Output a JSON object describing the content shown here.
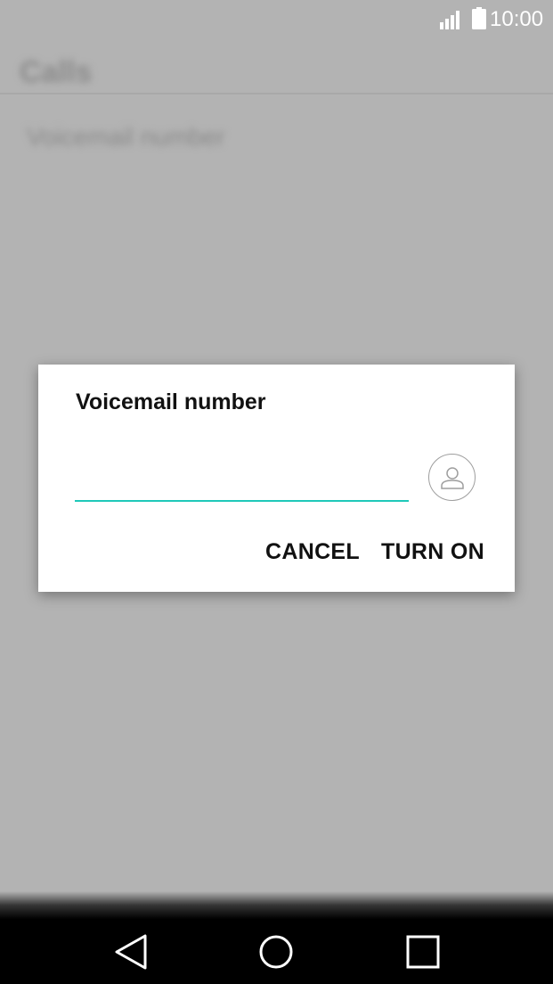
{
  "status_bar": {
    "time": "10:00",
    "signal_icon": "signal-icon",
    "battery_icon": "battery-icon"
  },
  "background": {
    "title": "Calls",
    "row_text": "Voicemail number"
  },
  "dialog": {
    "title": "Voicemail number",
    "input_value": "",
    "input_placeholder": "",
    "contact_icon": "contact-person-icon",
    "cancel_label": "CANCEL",
    "turn_on_label": "TURN ON",
    "accent_color": "#1fc8b9"
  },
  "nav_bar": {
    "back_icon": "back-triangle-icon",
    "home_icon": "home-circle-icon",
    "recent_icon": "recent-apps-square-icon"
  }
}
